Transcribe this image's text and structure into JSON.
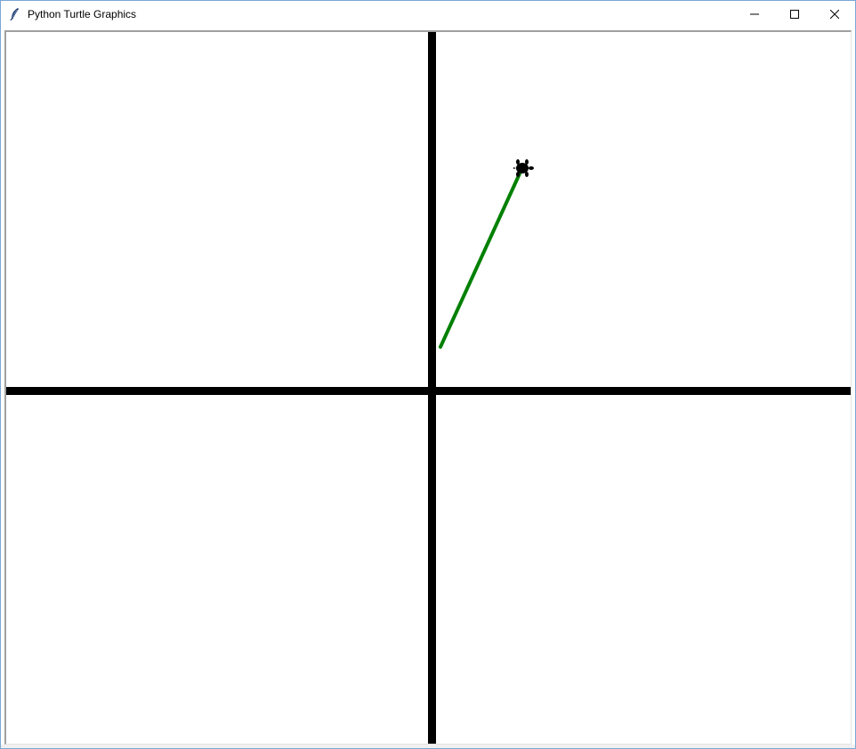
{
  "window": {
    "title": "Python Turtle Graphics"
  },
  "icons": {
    "app": "feather-icon",
    "minimize": "minimize-icon",
    "maximize": "maximize-icon",
    "close": "close-icon",
    "turtle": "turtle-icon"
  },
  "colors": {
    "axis": "#000000",
    "path": "#008000",
    "canvas_background": "#ffffff",
    "turtle": "#000000"
  }
}
